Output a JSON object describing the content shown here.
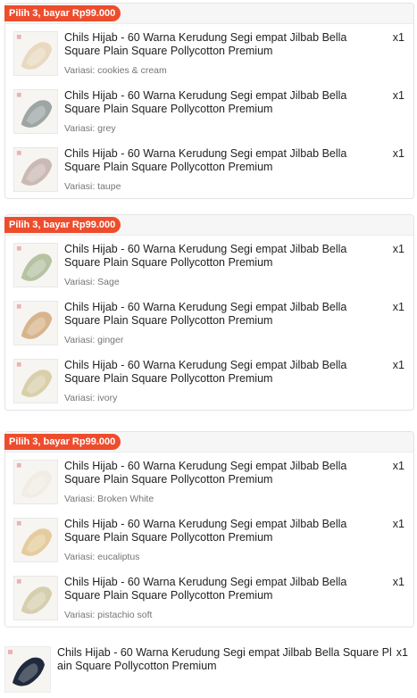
{
  "bundles": [
    {
      "badge": "Pilih 3, bayar Rp99.000",
      "items": [
        {
          "title": "Chils Hijab - 60 Warna Kerudung Segi empat Jilbab Bella Square Plain Square Pollycotton Premium",
          "qty": "x1",
          "variant": "Variasi: cookies & cream",
          "color": "#e9d9c0"
        },
        {
          "title": "Chils Hijab - 60 Warna Kerudung Segi empat Jilbab Bella Square Plain Square Pollycotton Premium",
          "qty": "x1",
          "variant": "Variasi: grey",
          "color": "#9ea5a5"
        },
        {
          "title": "Chils Hijab - 60 Warna Kerudung Segi empat Jilbab Bella Square Plain Square Pollycotton Premium",
          "qty": "x1",
          "variant": "Variasi: taupe",
          "color": "#cbb9b4"
        }
      ]
    },
    {
      "badge": "Pilih 3, bayar Rp99.000",
      "items": [
        {
          "title": "Chils Hijab - 60 Warna Kerudung Segi empat Jilbab Bella Square Plain Square Pollycotton Premium",
          "qty": "x1",
          "variant": "Variasi: Sage",
          "color": "#b6c3a3"
        },
        {
          "title": "Chils Hijab - 60 Warna Kerudung Segi empat Jilbab Bella Square Plain Square Pollycotton Premium",
          "qty": "x1",
          "variant": "Variasi: ginger",
          "color": "#d8b48c"
        },
        {
          "title": "Chils Hijab - 60 Warna Kerudung Segi empat Jilbab Bella Square Plain Square Pollycotton Premium",
          "qty": "x1",
          "variant": "Variasi: ivory",
          "color": "#d9cfaa"
        }
      ]
    },
    {
      "badge": "Pilih 3, bayar Rp99.000",
      "items": [
        {
          "title": "Chils Hijab - 60 Warna Kerudung Segi empat Jilbab Bella Square Plain Square Pollycotton Premium",
          "qty": "x1",
          "variant": "Variasi: Broken White",
          "color": "#f1ede4"
        },
        {
          "title": "Chils Hijab - 60 Warna Kerudung Segi empat Jilbab Bella Square Plain Square Pollycotton Premium",
          "qty": "x1",
          "variant": "Variasi: eucaliptus",
          "color": "#e5cc9e"
        },
        {
          "title": "Chils Hijab - 60 Warna Kerudung Segi empat Jilbab Bella Square Plain Square Pollycotton Premium",
          "qty": "x1",
          "variant": "Variasi: pistachio soft",
          "color": "#d6cfae"
        }
      ]
    }
  ],
  "single_item": {
    "title": "Chils Hijab - 60 Warna Kerudung Segi empat Jilbab Bella Square Pl ain Square Pollycotton Premium",
    "qty": "x1",
    "color": "#1f2a3d"
  },
  "accent_color": "#ee4d2d"
}
